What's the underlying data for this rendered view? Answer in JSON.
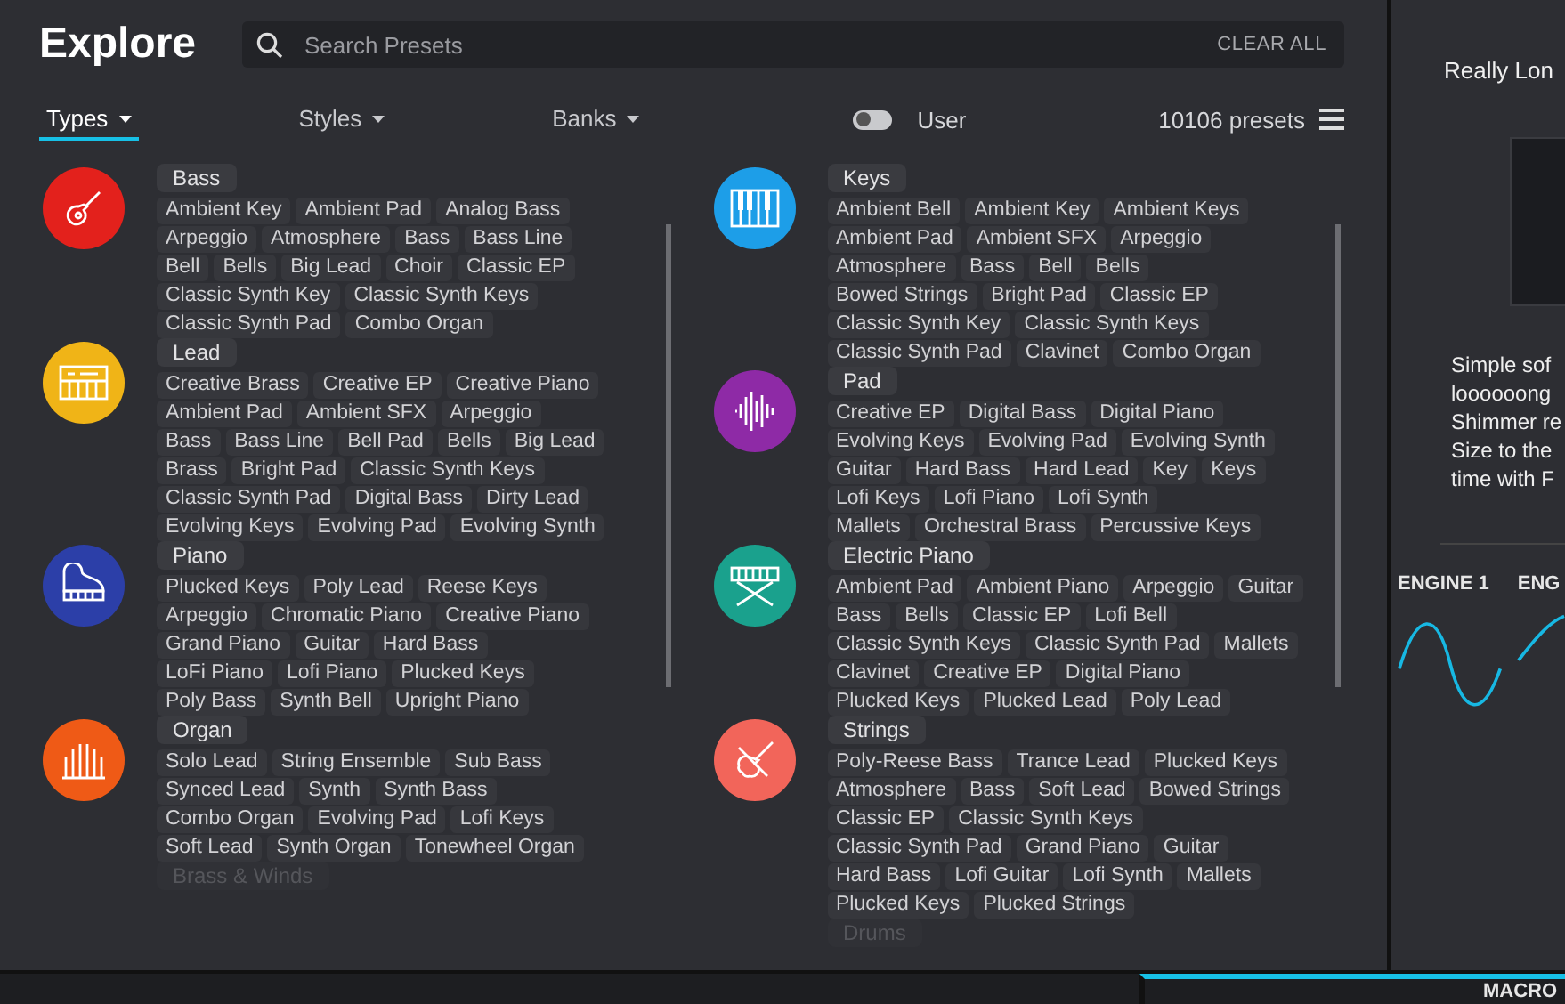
{
  "title": "Explore",
  "search": {
    "placeholder": "Search Presets",
    "clear": "CLEAR ALL"
  },
  "filters": [
    {
      "label": "Types",
      "selected": true
    },
    {
      "label": "Styles",
      "selected": false
    },
    {
      "label": "Banks",
      "selected": false
    }
  ],
  "user_toggle": {
    "label": "User",
    "on": false
  },
  "count": "10106 presets",
  "columns": [
    {
      "groups": [
        {
          "name": "Bass",
          "kind": "guitar",
          "color": "#e3211c",
          "faded": false,
          "tags": [
            [
              "Ambient Key",
              "Ambient Pad",
              "Analog Bass"
            ],
            [
              "Arpeggio",
              "Atmosphere",
              "Bass",
              "Bass Line"
            ],
            [
              "Bell",
              "Bells",
              "Big Lead",
              "Choir",
              "Classic EP"
            ],
            [
              "Classic Synth Key",
              "Classic Synth Keys"
            ],
            [
              "Classic Synth Pad",
              "Combo Organ"
            ]
          ]
        },
        {
          "name": "Lead",
          "kind": "synth",
          "color": "#f0b417",
          "faded": false,
          "tags": [
            [
              "Creative Brass",
              "Creative EP",
              "Creative Piano"
            ],
            [
              "Ambient Pad",
              "Ambient SFX",
              "Arpeggio"
            ],
            [
              "Bass",
              "Bass Line",
              "Bell Pad",
              "Bells",
              "Big Lead"
            ],
            [
              "Brass",
              "Bright Pad",
              "Classic Synth Keys"
            ],
            [
              "Classic Synth Pad",
              "Digital Bass",
              "Dirty Lead"
            ],
            [
              "Evolving Keys",
              "Evolving Pad",
              "Evolving Synth"
            ]
          ]
        },
        {
          "name": "Piano",
          "kind": "piano",
          "color": "#2c3fa8",
          "faded": false,
          "tags": [
            [
              "Plucked Keys",
              "Poly Lead",
              "Reese Keys"
            ],
            [
              "Arpeggio",
              "Chromatic Piano",
              "Creative Piano"
            ],
            [
              "Grand Piano",
              "Guitar",
              "Hard Bass"
            ],
            [
              "LoFi Piano",
              "Lofi Piano",
              "Plucked Keys"
            ],
            [
              "Poly Bass",
              "Synth Bell",
              "Upright Piano"
            ]
          ]
        },
        {
          "name": "Organ",
          "kind": "organ",
          "color": "#ef5a16",
          "faded": false,
          "tags": [
            [
              "Solo Lead",
              "String Ensemble",
              "Sub Bass"
            ],
            [
              "Synced Lead",
              "Synth",
              "Synth Bass"
            ],
            [
              "Combo Organ",
              "Evolving Pad",
              "Lofi Keys"
            ],
            [
              "Soft Lead",
              "Synth Organ",
              "Tonewheel Organ"
            ]
          ]
        },
        {
          "name": "Brass & Winds",
          "faded": true
        }
      ]
    },
    {
      "groups": [
        {
          "name": "Keys",
          "kind": "keyboard",
          "color": "#1d9ee8",
          "faded": false,
          "tags": [
            [
              "Ambient Bell",
              "Ambient Key",
              "Ambient Keys"
            ],
            [
              "Ambient Pad",
              "Ambient SFX",
              "Arpeggio"
            ],
            [
              "Atmosphere",
              "Bass",
              "Bell",
              "Bells"
            ],
            [
              "Bowed Strings",
              "Bright Pad",
              "Classic EP"
            ],
            [
              "Classic Synth Key",
              "Classic Synth Keys"
            ],
            [
              "Classic Synth Pad",
              "Clavinet",
              "Combo Organ"
            ]
          ]
        },
        {
          "name": "Pad",
          "kind": "wave",
          "color": "#8e2aa6",
          "faded": false,
          "tags": [
            [
              "Creative EP",
              "Digital Bass",
              "Digital Piano"
            ],
            [
              "Evolving Keys",
              "Evolving Pad",
              "Evolving Synth"
            ],
            [
              "Guitar",
              "Hard Bass",
              "Hard Lead",
              "Key",
              "Keys"
            ],
            [
              "Lofi Keys",
              "Lofi Piano",
              "Lofi Synth"
            ],
            [
              "Mallets",
              "Orchestral Brass",
              "Percussive Keys"
            ]
          ]
        },
        {
          "name": "Electric Piano",
          "kind": "stage",
          "color": "#1aa18d",
          "faded": false,
          "tags": [
            [
              "Ambient Pad",
              "Ambient Piano",
              "Arpeggio",
              "Guitar"
            ],
            [
              "Bass",
              "Bells",
              "Classic EP",
              "Lofi Bell"
            ],
            [
              "Classic Synth Keys",
              "Classic Synth Pad",
              "Mallets"
            ],
            [
              "Clavinet",
              "Creative EP",
              "Digital Piano"
            ],
            [
              "Plucked Keys",
              "Plucked Lead",
              "Poly Lead"
            ]
          ]
        },
        {
          "name": "Strings",
          "kind": "violin",
          "color": "#f2655a",
          "faded": false,
          "tags": [
            [
              "Poly-Reese Bass",
              "Trance Lead",
              "Plucked Keys"
            ],
            [
              "Atmosphere",
              "Bass",
              "Soft Lead",
              "Bowed Strings"
            ],
            [
              "Classic EP",
              "Classic Synth Keys"
            ],
            [
              "Classic Synth Pad",
              "Grand Piano",
              "Guitar"
            ],
            [
              "Hard Bass",
              "Lofi Guitar",
              "Lofi Synth",
              "Mallets"
            ],
            [
              "Plucked Keys",
              "Plucked Strings"
            ]
          ]
        },
        {
          "name": "Drums",
          "faded": true
        }
      ]
    }
  ],
  "side": {
    "title": "Really Lon",
    "description_lines": [
      "Simple sof",
      "loooooong",
      "Shimmer re",
      "Size to the",
      "time with F"
    ],
    "engines": [
      "ENGINE 1",
      "ENG"
    ]
  },
  "bottom": {
    "tab": "MACRO"
  }
}
